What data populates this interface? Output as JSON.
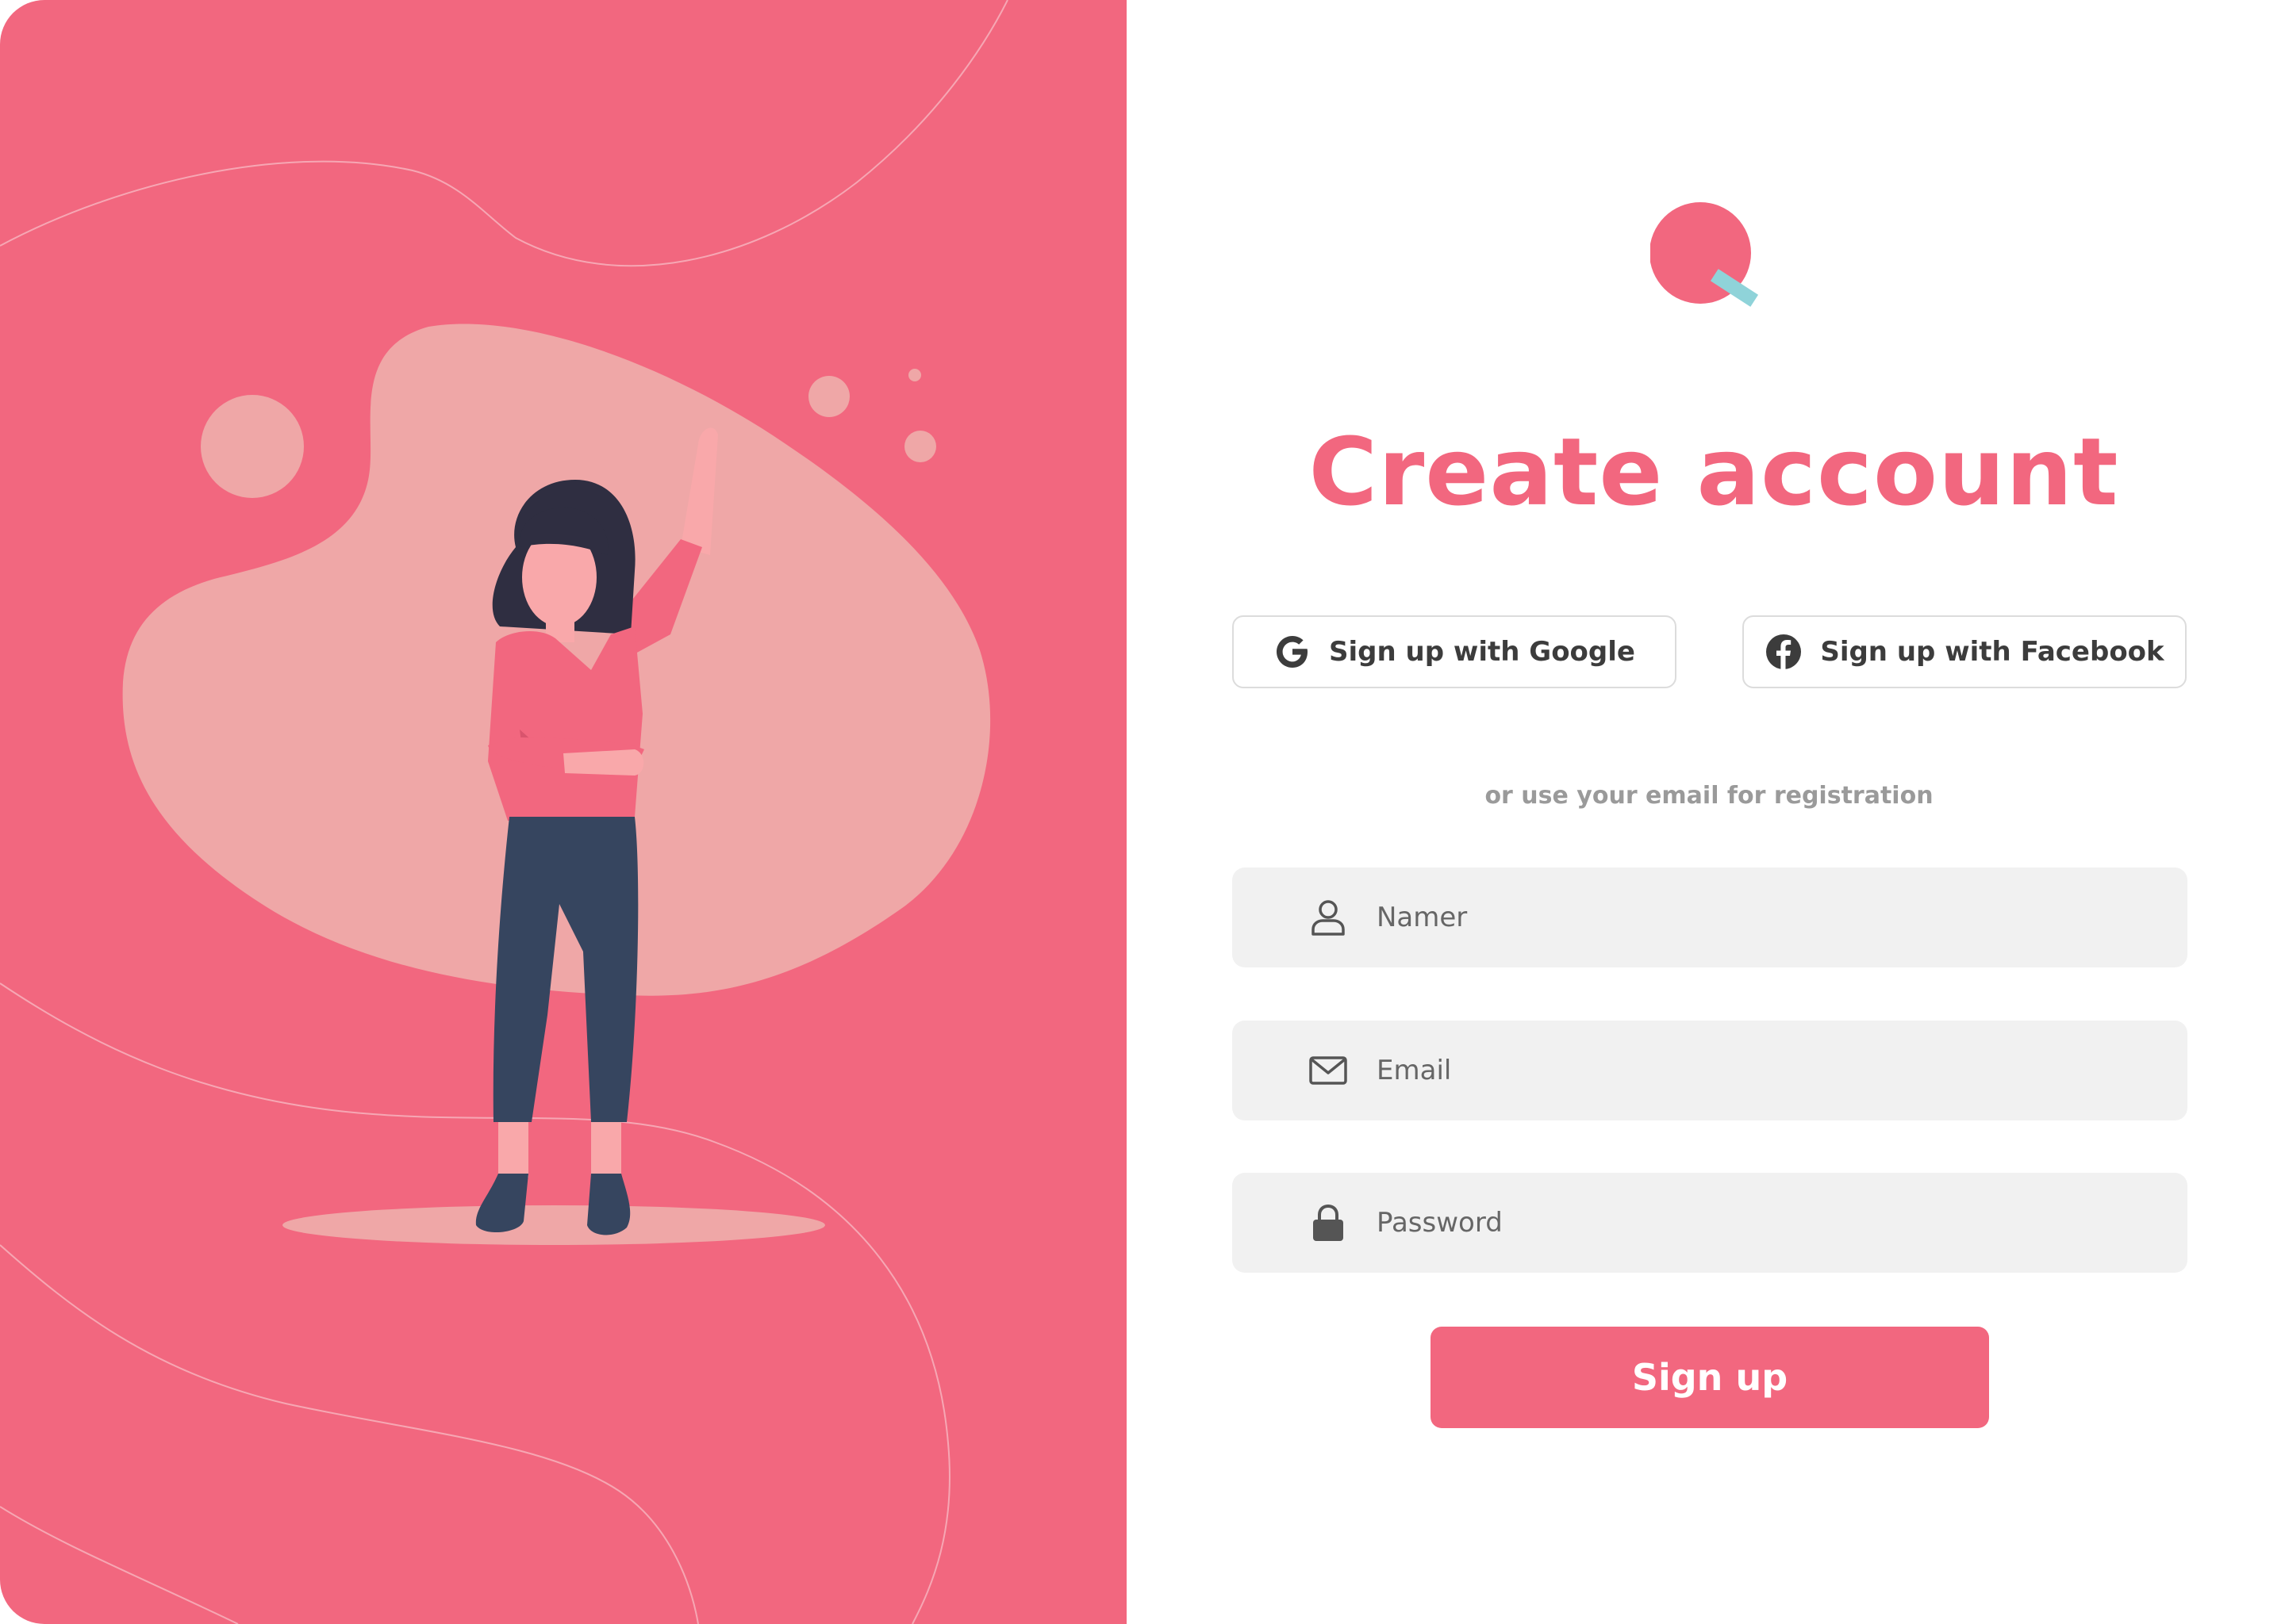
{
  "colors": {
    "accent": "#f2677f",
    "blob": "#efa7a7",
    "logo_stroke": "#8fd3d9",
    "field_bg": "#f1f1f1",
    "text_dark": "#3c3c3c",
    "text_muted": "#9a9a9a",
    "pants": "#36455f",
    "hair": "#2f2e41",
    "skin": "#f9a8aa"
  },
  "illustration": {
    "description_icon": "woman-waving-illustration"
  },
  "logo": {
    "icon": "q-logo-icon"
  },
  "heading": {
    "title": "Create account"
  },
  "social": {
    "google": {
      "label": "Sign up with Google",
      "icon": "google-icon"
    },
    "facebook": {
      "label": "Sign up with Facebook",
      "icon": "facebook-icon"
    }
  },
  "divider": {
    "text": "or use your email for registration"
  },
  "form": {
    "name": {
      "placeholder": "Namer",
      "value": "",
      "icon": "user-icon"
    },
    "email": {
      "placeholder": "Email",
      "value": "",
      "icon": "mail-icon"
    },
    "password": {
      "placeholder": "Password",
      "value": "",
      "icon": "lock-icon"
    },
    "submit_label": "Sign up"
  }
}
